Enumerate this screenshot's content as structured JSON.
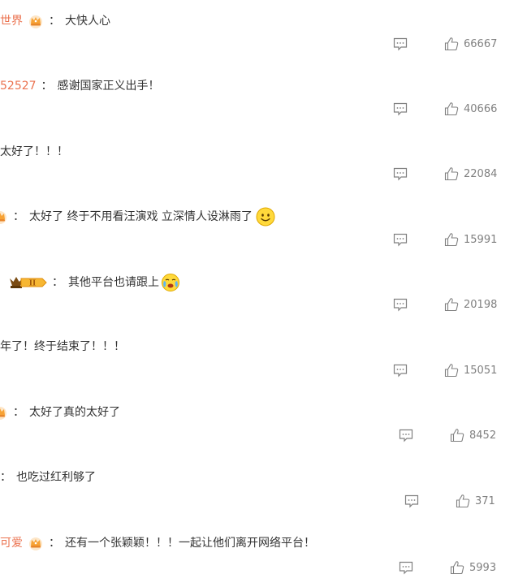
{
  "comments": [
    {
      "username": "世界",
      "has_crown": true,
      "text": "大快人心",
      "likes": "66667"
    },
    {
      "username": "52527",
      "has_crown": false,
      "text": "感谢国家正义出手！",
      "likes": "40666"
    },
    {
      "username": "",
      "has_crown": false,
      "text": "太好了！！！",
      "likes": "22084"
    },
    {
      "username": "",
      "has_crown": true,
      "text": "太好了 终于不用看汪演戏 立深情人设淋雨了",
      "emoji": "smile-emoji",
      "likes": "15991"
    },
    {
      "username": "",
      "has_crown": false,
      "vip_badge_text": "II",
      "text": "其他平台也请跟上",
      "emoji": "crying-emoji",
      "likes": "20198"
    },
    {
      "username": "",
      "has_crown": false,
      "text": "年了！终于结束了！！！",
      "likes": "15051"
    },
    {
      "username": "",
      "has_crown": true,
      "text": "太好了真的太好了",
      "likes": "8452"
    },
    {
      "username": "",
      "has_crown": false,
      "text": "也吃过红利够了",
      "likes": "371"
    },
    {
      "username": "可爱",
      "has_crown": true,
      "text": "还有一个张颖颖！！！一起让他们离开网络平台！",
      "likes": "5993"
    }
  ],
  "colors": {
    "username": "#eb7350",
    "text": "#333333",
    "meta": "#808080"
  }
}
